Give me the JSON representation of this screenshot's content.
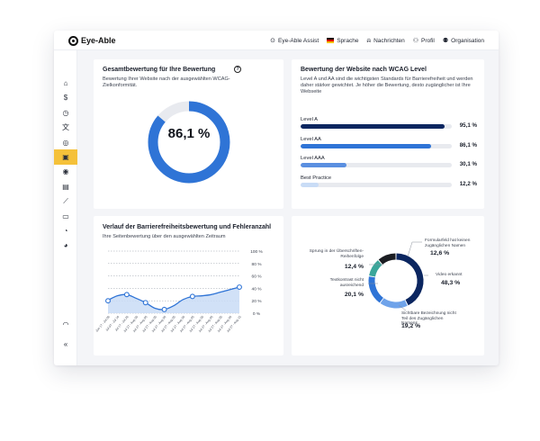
{
  "app": {
    "name": "Eye-Able"
  },
  "nav": {
    "items": [
      {
        "label": "Eye-Able Assist",
        "icon": "eye-able-assist-icon"
      },
      {
        "label": "Sprache",
        "icon": "flag-germany-icon"
      },
      {
        "label": "Nachrichten",
        "icon": "bell-icon"
      },
      {
        "label": "Profil",
        "icon": "user-icon"
      },
      {
        "label": "Organisation",
        "icon": "organisation-icon"
      }
    ]
  },
  "sidebar": {
    "items": [
      {
        "icon": "home-icon",
        "active": false
      },
      {
        "icon": "dollar-icon",
        "active": false
      },
      {
        "icon": "clock-icon",
        "active": false
      },
      {
        "icon": "translate-icon",
        "active": false
      },
      {
        "icon": "fingerprint-icon",
        "active": false
      },
      {
        "icon": "clipboard-check-icon",
        "active": true
      },
      {
        "icon": "target-icon",
        "active": false
      },
      {
        "icon": "pdf-document-icon",
        "active": false
      },
      {
        "icon": "trend-chart-icon",
        "active": false
      },
      {
        "icon": "document-icon",
        "active": false
      },
      {
        "icon": "pie-chart-icon",
        "active": false
      },
      {
        "icon": "pie-chart-alt-icon",
        "active": false
      }
    ],
    "bottom": [
      {
        "icon": "support-icon"
      },
      {
        "icon": "collapse-icon"
      }
    ]
  },
  "overall": {
    "title": "Gesamtbewertung für Ihre Bewertung",
    "description": "Bewertung Ihrer Website nach der ausgewählten WCAG-Zielkonformität.",
    "value": 86.1,
    "value_label": "86,1 %",
    "color": "#2f74d6",
    "track_color": "#e8eaef"
  },
  "wcag": {
    "title": "Bewertung der Website nach WCAG Level",
    "description": "Level A und AA sind die wichtigsten Standards für Barrierefreiheit und werden daher stärker gewichtet. Je höher die Bewertung, desto zugänglicher ist Ihre Webseite",
    "levels": [
      {
        "label": "Level A",
        "value": 95.1,
        "value_label": "95,1 %",
        "color": "#0b2660"
      },
      {
        "label": "Level AA",
        "value": 86.1,
        "value_label": "86,1 %",
        "color": "#2f74d6"
      },
      {
        "label": "Level AAA",
        "value": 30.1,
        "value_label": "30,1 %",
        "color": "#5a8fe0"
      },
      {
        "label": "Best Practice",
        "value": 12.2,
        "value_label": "12,2 %",
        "color": "#c9dcf6"
      }
    ]
  },
  "chart_data": [
    {
      "type": "area",
      "title": "Verlauf der Barrierefreiheitsbewertung und Fehleranzahl",
      "subtitle": "Ihre Seitenbewertung über den ausgewählten Zeitraum",
      "categories": [
        "Jun 17 - Jul 06",
        "Jul 07 - Jul 16",
        "Jul 17 - Jul 26",
        "Jul 27 - Aug 05",
        "Jul 27 - Aug 05",
        "Jul 27 - Aug 05",
        "Jul 27 - Aug 05",
        "Jul 27 - Aug 05",
        "Jul 27 - Aug 05",
        "Jul 27 - Aug 05",
        "Jul 27 - Aug 05",
        "Jul 27 - Aug 05",
        "Jul 27 - Aug 05",
        "Jul 27 - Aug 05",
        "Jul 27 - Aug 15"
      ],
      "markers": [
        {
          "x": 0,
          "y": 20
        },
        {
          "x": 2,
          "y": 30
        },
        {
          "x": 4,
          "y": 17
        },
        {
          "x": 6,
          "y": 6
        },
        {
          "x": 9,
          "y": 27
        },
        {
          "x": 14,
          "y": 42
        }
      ],
      "line": [
        21,
        28,
        30,
        24,
        17,
        8,
        6,
        12,
        22,
        27,
        28,
        30,
        34,
        38,
        42
      ],
      "y_ticks": [
        "0 %",
        "20 %",
        "40 %",
        "60 %",
        "80 %",
        "100 %"
      ],
      "ylim": [
        0,
        100
      ],
      "color": "#2f74d6",
      "fill_color": "#c9dcf6"
    },
    {
      "type": "pie",
      "segments": [
        {
          "label": "Video erkannt",
          "value": 48.3,
          "value_label": "48,3 %",
          "color": "#0b2660"
        },
        {
          "label": "Sichtbare Bezeichnung nicht Teil des Zugänglichen Namens",
          "value": 19.2,
          "value_label": "19,2 %",
          "color": "#6fa3ea"
        },
        {
          "label": "Textkontrast nicht ausreichend",
          "value": 20.1,
          "value_label": "20,1 %",
          "color": "#2f74d6"
        },
        {
          "label": "Sprung in der Überschriften-Reihenfolge",
          "value": 12.4,
          "value_label": "12,4 %",
          "color": "#3aa69a"
        },
        {
          "label": "Formularfeld hat keinen zugänglichen Namen",
          "value": 12.6,
          "value_label": "12,6 %",
          "color": "#1b1d22"
        }
      ]
    }
  ]
}
